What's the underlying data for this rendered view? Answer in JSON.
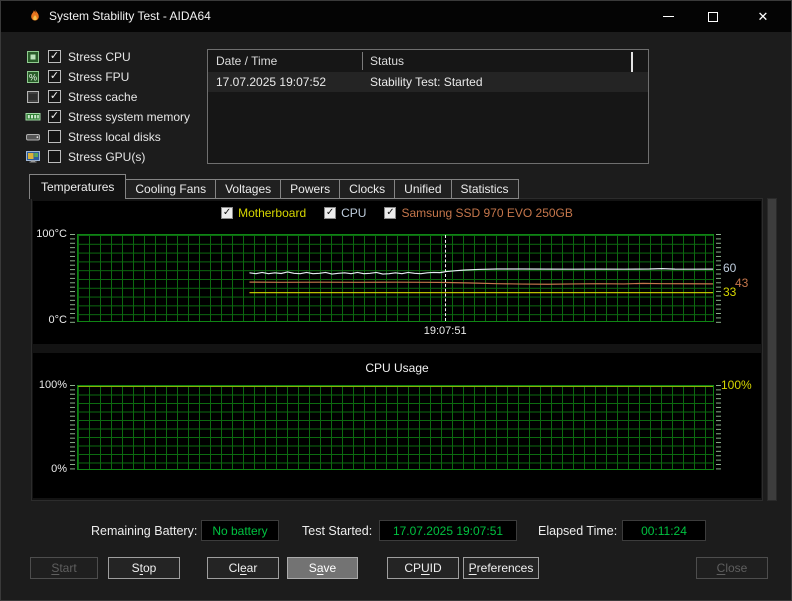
{
  "window": {
    "title": "System Stability Test - AIDA64",
    "controls": {
      "close_glyph": "✕"
    }
  },
  "stress": {
    "items": [
      {
        "label": "Stress CPU",
        "mark": "✓",
        "icon": "cpu-icon"
      },
      {
        "label": "Stress FPU",
        "mark": "✓",
        "icon": "fpu-icon"
      },
      {
        "label": "Stress cache",
        "mark": "✓",
        "icon": "cache-icon"
      },
      {
        "label": "Stress system memory",
        "mark": "✓",
        "icon": "memory-icon"
      },
      {
        "label": "Stress local disks",
        "mark": "",
        "icon": "disk-icon"
      },
      {
        "label": "Stress GPU(s)",
        "mark": "",
        "icon": "gpu-icon"
      }
    ]
  },
  "log": {
    "columns": [
      "Date / Time",
      "Status"
    ],
    "rows": [
      {
        "datetime": "17.07.2025 19:07:52",
        "status": "Stability Test: Started"
      }
    ]
  },
  "tabs": [
    {
      "label": "Temperatures",
      "active": true
    },
    {
      "label": "Cooling Fans",
      "active": false
    },
    {
      "label": "Voltages",
      "active": false
    },
    {
      "label": "Powers",
      "active": false
    },
    {
      "label": "Clocks",
      "active": false
    },
    {
      "label": "Unified",
      "active": false
    },
    {
      "label": "Statistics",
      "active": false
    }
  ],
  "legend": {
    "mark": "✓"
  },
  "chart_data": [
    {
      "type": "line",
      "title": "Temperatures",
      "y_top_label": "100°C",
      "y_bottom_label": "0°C",
      "ylim": [
        0,
        100
      ],
      "grid": true,
      "legend_position": "top-center",
      "marker_time": "19:07:51",
      "marker_x": 57.8,
      "series": [
        {
          "name": "Motherboard",
          "color": "#d6d600",
          "label_color": "#d6d600",
          "current": 33,
          "z": 1,
          "points": [
            [
              27,
              33
            ],
            [
              100,
              33
            ]
          ]
        },
        {
          "name": "CPU",
          "color": "#e4ebf2",
          "label_color": "#becddd",
          "current": 60,
          "z": 2,
          "points": [
            [
              27,
              56
            ],
            [
              28,
              55
            ],
            [
              29,
              56.5
            ],
            [
              30,
              55
            ],
            [
              31,
              56
            ],
            [
              32,
              55.2
            ],
            [
              33,
              57
            ],
            [
              34,
              55.5
            ],
            [
              35,
              55
            ],
            [
              36,
              56.5
            ],
            [
              37,
              55
            ],
            [
              38,
              55.5
            ],
            [
              39,
              56.5
            ],
            [
              40,
              54.5
            ],
            [
              41,
              55.5
            ],
            [
              42,
              56
            ],
            [
              43,
              55
            ],
            [
              44,
              56.5
            ],
            [
              45,
              55
            ],
            [
              46,
              55.5
            ],
            [
              47,
              56.5
            ],
            [
              48,
              54.5
            ],
            [
              49,
              55
            ],
            [
              50,
              56
            ],
            [
              51,
              55
            ],
            [
              52,
              56.5
            ],
            [
              53,
              55.5
            ],
            [
              54,
              55
            ],
            [
              55,
              56
            ],
            [
              56,
              56.5
            ],
            [
              57,
              56.2
            ],
            [
              58,
              57.5
            ],
            [
              59.5,
              58.5
            ],
            [
              61,
              59.3
            ],
            [
              63,
              60
            ],
            [
              66,
              60.4
            ],
            [
              70,
              60.5
            ],
            [
              74,
              60.3
            ],
            [
              78,
              60.2
            ],
            [
              82,
              60.3
            ],
            [
              86,
              60.2
            ],
            [
              90,
              60.4
            ],
            [
              92,
              60.9
            ],
            [
              94,
              60.3
            ],
            [
              97,
              60.2
            ],
            [
              100,
              60.3
            ]
          ]
        },
        {
          "name": "Samsung SSD 970 EVO 250GB",
          "color": "#c5764b",
          "label_color": "#c5764b",
          "current": 43,
          "z": 1,
          "points": [
            [
              27,
              45.2
            ],
            [
              32,
              45
            ],
            [
              38,
              45.1
            ],
            [
              44,
              45
            ],
            [
              50,
              45.1
            ],
            [
              55,
              45
            ],
            [
              58,
              44.8
            ],
            [
              62,
              44.2
            ],
            [
              66,
              43.4
            ],
            [
              70,
              42.9
            ],
            [
              74,
              42.7
            ],
            [
              78,
              43.1
            ],
            [
              82,
              43.4
            ],
            [
              86,
              43.1
            ],
            [
              89,
              43.7
            ],
            [
              92,
              43.4
            ],
            [
              96,
              43.3
            ],
            [
              100,
              43.2
            ]
          ]
        }
      ]
    },
    {
      "type": "line",
      "title": "CPU Usage",
      "y_top_label": "100%",
      "y_bottom_label": "0%",
      "right_label": "100%",
      "ylim": [
        0,
        100
      ],
      "grid": true,
      "series": [
        {
          "name": "CPU Usage",
          "color": "#d6d600",
          "label_color": "#d6d600",
          "z": 1,
          "points": [
            [
              0,
              100
            ],
            [
              100,
              100
            ]
          ]
        }
      ]
    }
  ],
  "status_bar": {
    "battery_label": "Remaining Battery:",
    "battery_value": "No battery",
    "started_label": "Test Started:",
    "started_value": "17.07.2025 19:07:51",
    "elapsed_label": "Elapsed Time:",
    "elapsed_value": "00:11:24",
    "value_color": "#00c140"
  },
  "buttons": {
    "start": {
      "pre": "",
      "u": "S",
      "post": "tart",
      "enabled": false
    },
    "stop": {
      "pre": "S",
      "u": "t",
      "post": "op",
      "enabled": true
    },
    "clear": {
      "pre": "Cl",
      "u": "e",
      "post": "ar",
      "enabled": true
    },
    "save": {
      "pre": "S",
      "u": "a",
      "post": "ve",
      "enabled": true
    },
    "cpuid": {
      "pre": "CP",
      "u": "U",
      "post": "ID",
      "enabled": true
    },
    "preferences": {
      "pre": "",
      "u": "P",
      "post": "references",
      "enabled": true
    },
    "close": {
      "pre": "",
      "u": "C",
      "post": "lose",
      "enabled": false
    }
  },
  "colors": {
    "grid_green": "#0c6a10",
    "grid_border_green": "#0f8414",
    "status_green": "#00c140",
    "titlebar": "#040404",
    "window_bg": "#1c1c1c"
  }
}
